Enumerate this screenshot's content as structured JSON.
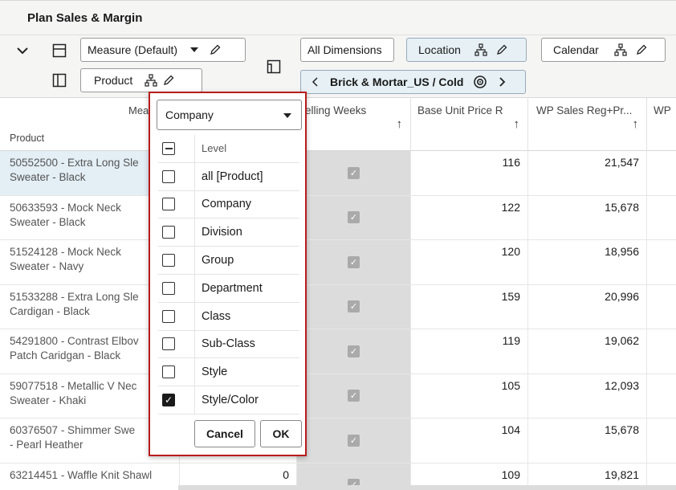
{
  "title": "Plan Sales & Margin",
  "toolbar": {
    "measure_label": "Measure (Default)",
    "product_label": "Product",
    "all_dimensions_label": "All Dimensions",
    "location_label": "Location",
    "calendar_label": "Calendar",
    "breadcrumb_label": "Brick & Mortar_US / Cold"
  },
  "grid": {
    "headers": {
      "measure_partial": "Mea",
      "product": "Product",
      "selling_weeks_partial": "elling Weeks",
      "base_unit_price": "Base Unit Price R",
      "wp_sales": "WP Sales Reg+Pr...",
      "wp_partial": "WP",
      "sort_arrow": "↑"
    },
    "rows": [
      {
        "product_l1": "50552500 - Extra Long Sle",
        "product_l2": "Sweater - Black",
        "price": "116",
        "sales": "21,547",
        "units": ""
      },
      {
        "product_l1": "50633593 - Mock Neck",
        "product_l2": "Sweater - Black",
        "price": "122",
        "sales": "15,678",
        "units": ""
      },
      {
        "product_l1": "51524128 - Mock Neck",
        "product_l2": "Sweater - Navy",
        "price": "120",
        "sales": "18,956",
        "units": ""
      },
      {
        "product_l1": "51533288 - Extra Long Sle",
        "product_l2": "Cardigan - Black",
        "price": "159",
        "sales": "20,996",
        "units": ""
      },
      {
        "product_l1": "54291800 - Contrast Elbov",
        "product_l2": "Patch Caridgan - Black",
        "price": "119",
        "sales": "19,062",
        "units": ""
      },
      {
        "product_l1": "59077518 - Metallic V Nec",
        "product_l2": "Sweater - Khaki",
        "price": "105",
        "sales": "12,093",
        "units": ""
      },
      {
        "product_l1": "60376507 - Shimmer Swe",
        "product_l2": "- Pearl Heather",
        "price": "104",
        "sales": "15,678",
        "units": ""
      },
      {
        "product_l1": "63214451 - Waffle Knit Shawl",
        "product_l2": "",
        "price": "109",
        "sales": "19,821",
        "units": "0"
      }
    ]
  },
  "popup": {
    "selected_level": "Company",
    "list_header": "Level",
    "levels": [
      {
        "label": "all [Product]",
        "checked": false
      },
      {
        "label": "Company",
        "checked": false
      },
      {
        "label": "Division",
        "checked": false
      },
      {
        "label": "Group",
        "checked": false
      },
      {
        "label": "Department",
        "checked": false
      },
      {
        "label": "Class",
        "checked": false
      },
      {
        "label": "Sub-Class",
        "checked": false
      },
      {
        "label": "Style",
        "checked": false
      },
      {
        "label": "Style/Color",
        "checked": true
      }
    ],
    "cancel_label": "Cancel",
    "ok_label": "OK"
  }
}
